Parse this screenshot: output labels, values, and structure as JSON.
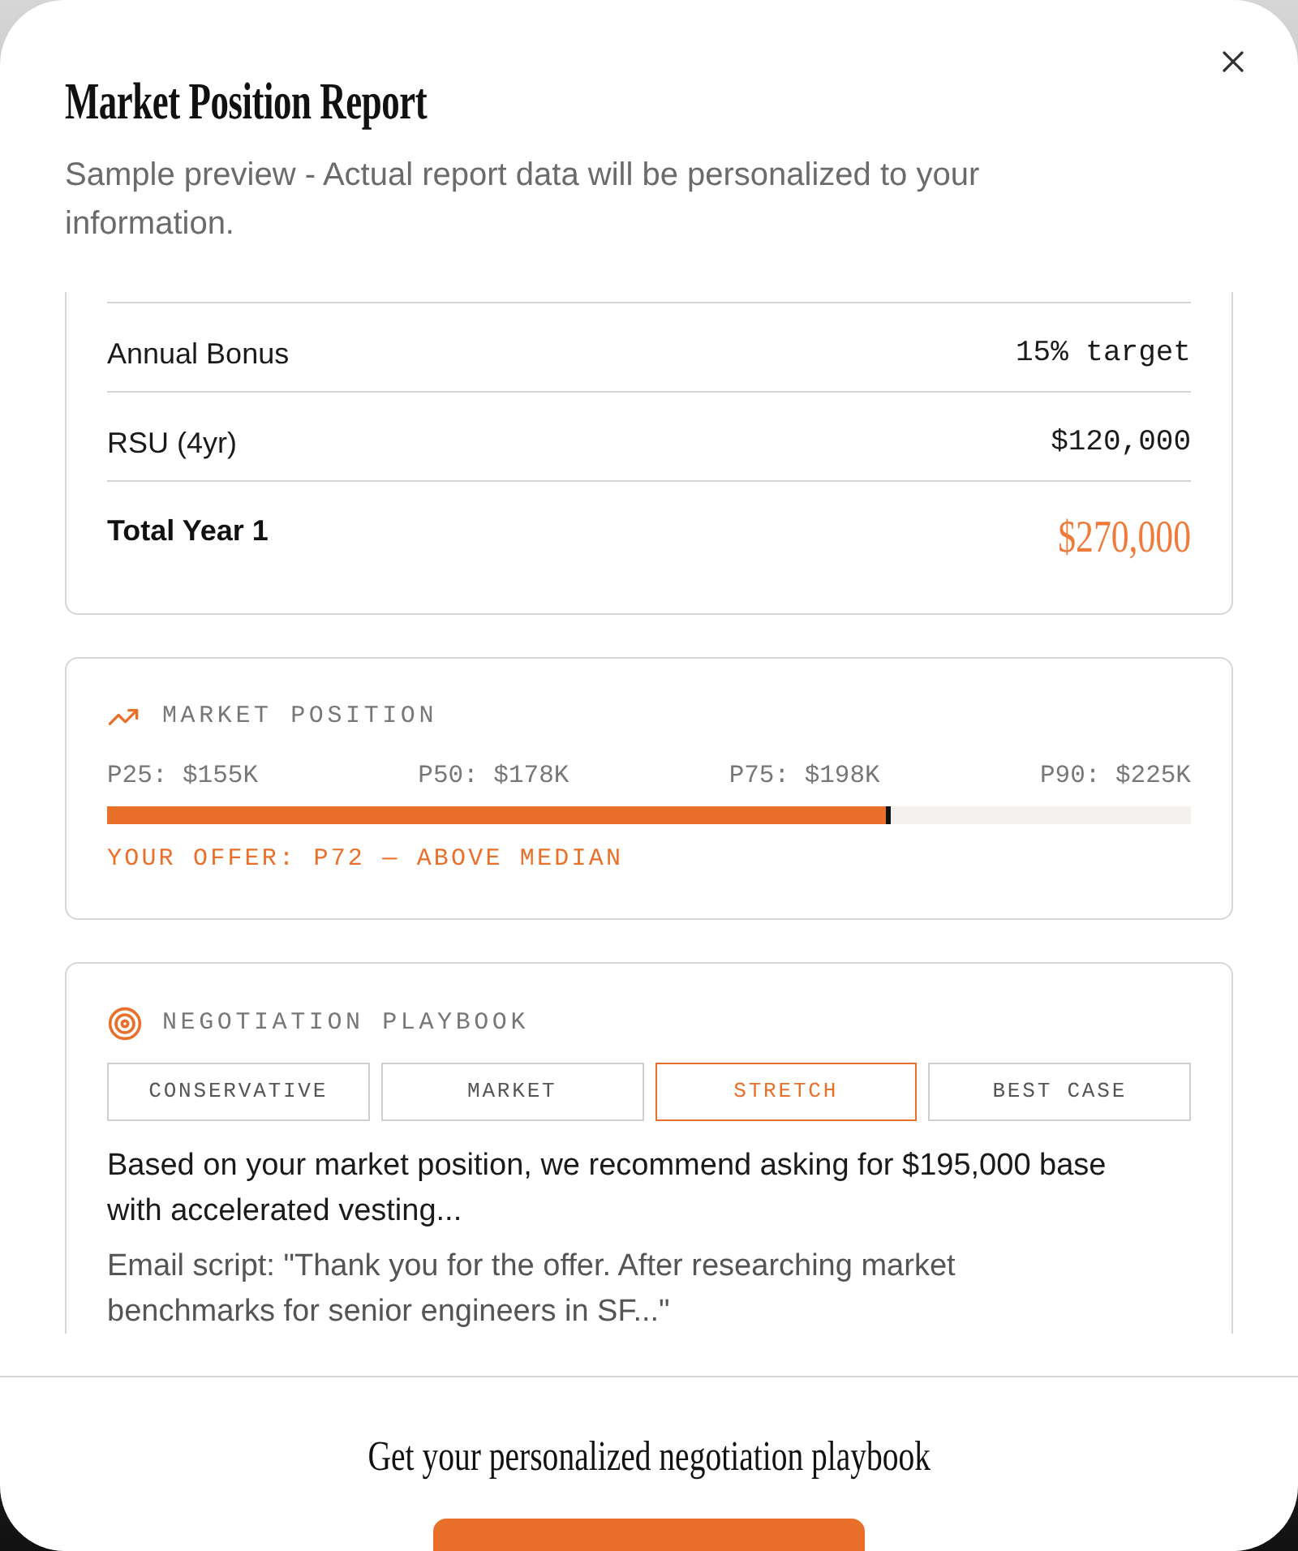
{
  "dialog": {
    "title": "Market Position Report",
    "subtitle": "Sample preview - Actual report data will be personalized to your information."
  },
  "compensation": {
    "rows": [
      {
        "kind": "line",
        "label": "Annual Bonus",
        "value": "15% target"
      },
      {
        "kind": "line",
        "label": "RSU (4yr)",
        "value": "$120,000"
      },
      {
        "kind": "total",
        "label": "Total Year 1",
        "value": "$270,000"
      }
    ]
  },
  "market_position": {
    "heading": "MARKET POSITION",
    "percentiles": [
      "P25: $155K",
      "P50: $178K",
      "P75: $198K",
      "P90: $225K"
    ],
    "level": 0.723,
    "offer": "YOUR OFFER: P72 — ABOVE MEDIAN"
  },
  "playbook": {
    "heading": "NEGOTIATION PLAYBOOK",
    "tabs": [
      {
        "label": "CONSERVATIVE",
        "selected": false
      },
      {
        "label": "MARKET",
        "selected": false
      },
      {
        "label": "STRETCH",
        "selected": true
      },
      {
        "label": "BEST CASE",
        "selected": false
      }
    ],
    "recommendation": "Based on your market position, we recommend asking for $195,000 base with accelerated vesting...",
    "email_script": "Email script: \"Thank you for the offer. After researching market benchmarks for senior engineers in SF...\""
  },
  "footer": {
    "prompt": "Get your personalized negotiation playbook"
  }
}
